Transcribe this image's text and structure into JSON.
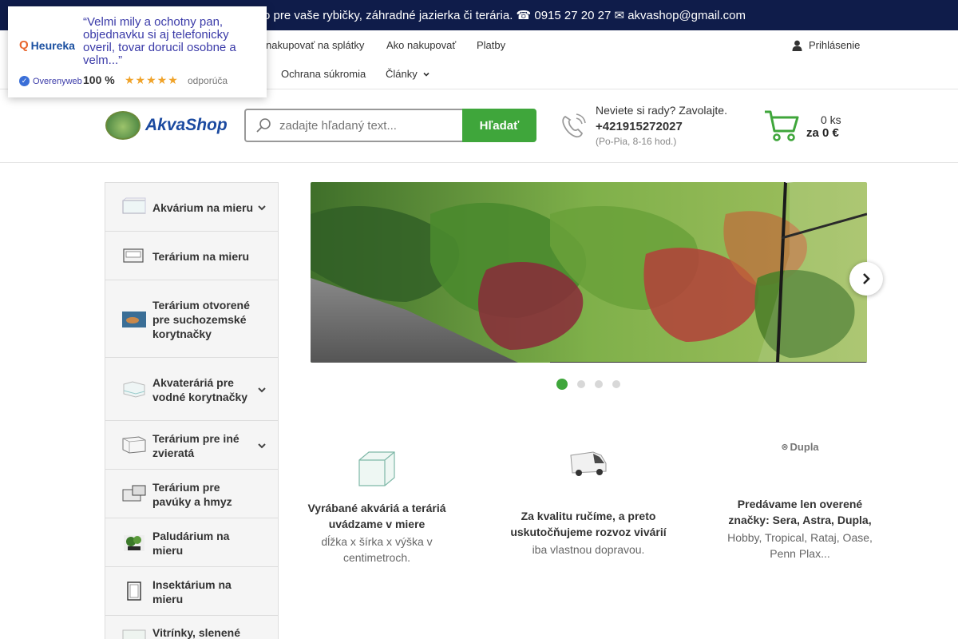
{
  "topbar": {
    "text": "o pre vaše rybičky, záhradné jazierka či terária. ☎ 0915 27 20 27 ✉ akvashop@gmail.com"
  },
  "nav": {
    "row1": [
      "nakupovať na splátky",
      "Ako nakupovať",
      "Platby"
    ],
    "row2": [
      "Ochrana súkromia",
      "Články"
    ],
    "login": "Prihlásenie"
  },
  "heureka": {
    "logo": "Heureka",
    "quote": "“Velmi mily a ochotny pan, objednavku si aj telefonicky overil, tovar dorucil osobne a velm...”",
    "verified": "Overenyweb",
    "percent": "100 %",
    "stars": "★★★★★",
    "recommends": "odporúča"
  },
  "header": {
    "logo_text": "AkvaShop",
    "search_placeholder": "zadajte hľadaný text...",
    "search_button": "Hľadať",
    "phone_question": "Neviete si rady? Zavolajte.",
    "phone_number": "+421915272027",
    "phone_hours": "(Po-Pia, 8-16 hod.)",
    "cart_count": "0 ks",
    "cart_total": "za 0 €"
  },
  "sidebar": {
    "categories": [
      {
        "label": "Akvárium na mieru",
        "icon": "aquarium-icon",
        "expandable": true
      },
      {
        "label": "Terárium na mieru",
        "icon": "terrarium-icon",
        "expandable": false
      },
      {
        "label": "Terárium otvorené pre suchozemské korytnačky",
        "icon": "turtle-terrarium-icon",
        "expandable": false
      },
      {
        "label": "Akvateráriá pre vodné korytnačky",
        "icon": "aquaterrarium-icon",
        "expandable": true
      },
      {
        "label": "Terárium pre iné zvieratá",
        "icon": "animal-terrarium-icon",
        "expandable": true
      },
      {
        "label": "Terárium pre pavúky a hmyz",
        "icon": "spider-terrarium-icon",
        "expandable": false
      },
      {
        "label": "Paludárium na mieru",
        "icon": "paludarium-icon",
        "expandable": false
      },
      {
        "label": "Insektárium na mieru",
        "icon": "insectarium-icon",
        "expandable": false
      },
      {
        "label": "Vitrínky, slenené",
        "icon": "showcase-icon",
        "expandable": false
      }
    ]
  },
  "slider": {
    "slide_count": 4,
    "active_slide": 1
  },
  "features": [
    {
      "title": "Vyrábané akváriá a teráriá uvádzame v miere",
      "desc": "dĺžka x šírka x výška v centimetroch.",
      "icon": "glass-tank-icon"
    },
    {
      "title": "Za kvalitu ručíme, a preto uskutočňujeme rozvoz vivárií",
      "desc": "iba vlastnou dopravou.",
      "icon": "delivery-van-icon"
    },
    {
      "title": "Predávame len overené značky: Sera, Astra, Dupla,",
      "desc": "Hobby, Tropical, Rataj, Oase, Penn Plax...",
      "icon": "dupla-logo",
      "logo_text": "Dupla"
    }
  ],
  "colors": {
    "topbar": "#0f1c4a",
    "accent_green": "#3fa63b",
    "brand_blue": "#1b4aa0"
  }
}
